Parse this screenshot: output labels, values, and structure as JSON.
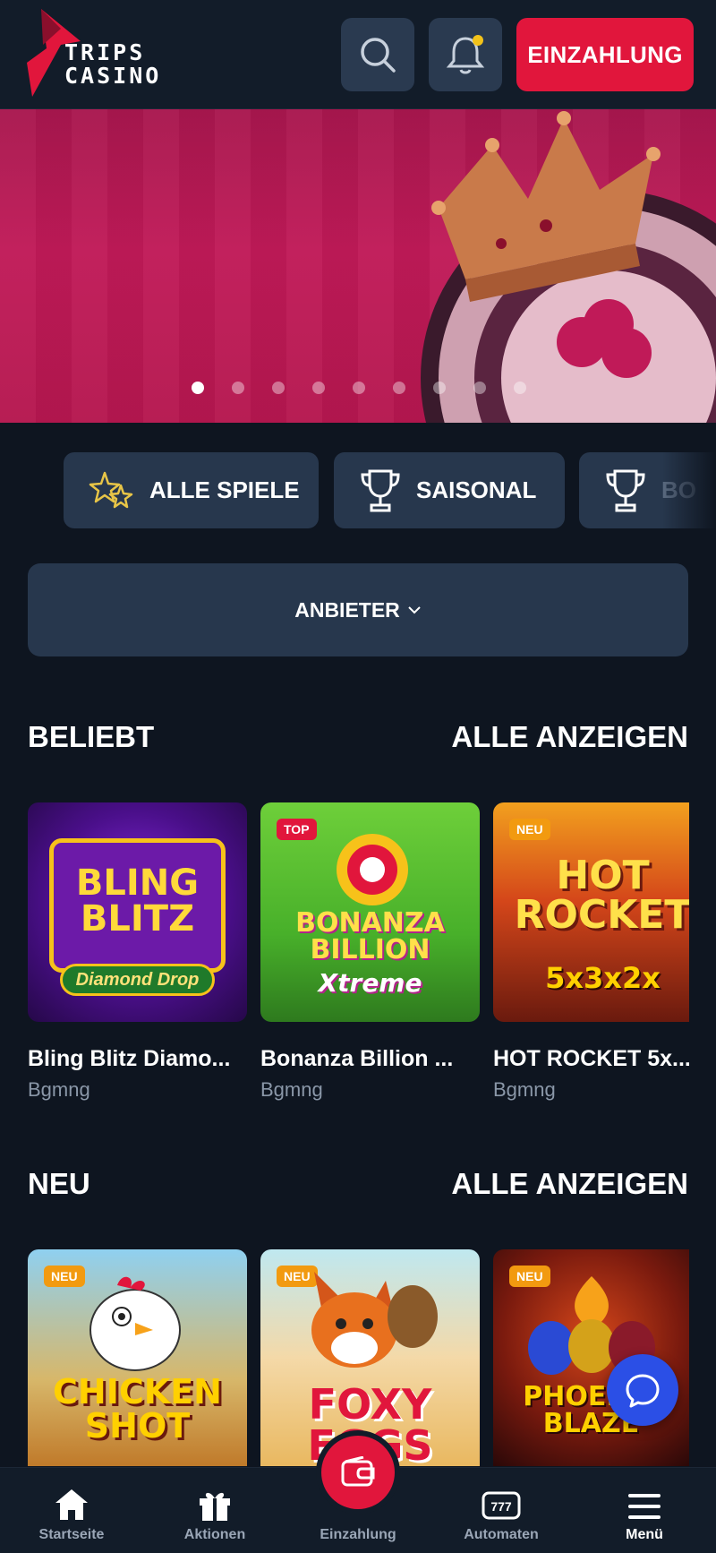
{
  "header": {
    "logo_line1": "TRIPS",
    "logo_line2": "CASINO",
    "deposit_label": "EINZAHLUNG",
    "accent": "#e1163c"
  },
  "banner": {
    "slide_count": 9,
    "active_index": 0
  },
  "categories": [
    {
      "label": "ALLE SPIELE",
      "icon": "stars-icon"
    },
    {
      "label": "SAISONAL",
      "icon": "trophy-icon"
    },
    {
      "label": "BO",
      "icon": "trophy-icon"
    }
  ],
  "provider_filter": {
    "label": "ANBIETER"
  },
  "sections": [
    {
      "title": "BELIEBT",
      "view_all": "ALLE ANZEIGEN",
      "games": [
        {
          "title": "Bling Blitz Diamo...",
          "provider": "Bgmng",
          "badge": "",
          "art": "BLING BLITZ",
          "art_sub": "Diamond Drop"
        },
        {
          "title": "Bonanza Billion ...",
          "provider": "Bgmng",
          "badge": "TOP",
          "art": "BONANZA BILLION",
          "art_sub": "Xtreme"
        },
        {
          "title": "HOT ROCKET 5x...",
          "provider": "Bgmng",
          "badge": "NEU",
          "art": "HOT ROCKET",
          "art_sub": "5x3x2x"
        }
      ]
    },
    {
      "title": "NEU",
      "view_all": "ALLE ANZEIGEN",
      "games": [
        {
          "badge": "NEU",
          "art": "CHICKEN SHOT"
        },
        {
          "badge": "NEU",
          "art": "FOXY EGGS"
        },
        {
          "badge": "NEU",
          "art": "PHOENIX BLAZE"
        }
      ]
    }
  ],
  "bottom_nav": [
    {
      "label": "Startseite",
      "icon": "home-icon"
    },
    {
      "label": "Aktionen",
      "icon": "gift-icon"
    },
    {
      "label": "Einzahlung",
      "icon": "wallet-icon"
    },
    {
      "label": "Automaten",
      "icon": "slots-icon"
    },
    {
      "label": "Menü",
      "icon": "menu-icon"
    }
  ]
}
